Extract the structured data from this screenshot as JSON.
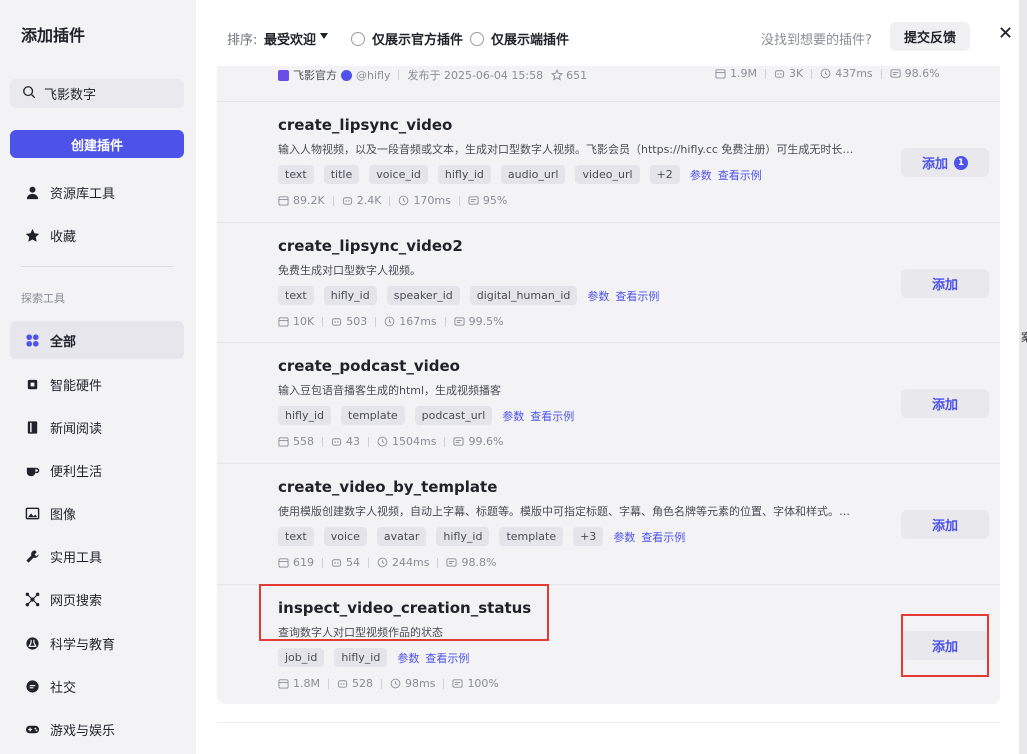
{
  "sidebar": {
    "title": "添加插件",
    "search_value": "飞影数字",
    "create_label": "创建插件",
    "items_top": [
      {
        "label": "资源库工具",
        "icon": "user-icon"
      },
      {
        "label": "收藏",
        "icon": "star-icon"
      }
    ],
    "section_label": "探索工具",
    "items": [
      {
        "label": "全部",
        "icon": "grid-icon",
        "active": true
      },
      {
        "label": "智能硬件",
        "icon": "chip-icon"
      },
      {
        "label": "新闻阅读",
        "icon": "book-icon"
      },
      {
        "label": "便利生活",
        "icon": "cup-icon"
      },
      {
        "label": "图像",
        "icon": "image-icon"
      },
      {
        "label": "实用工具",
        "icon": "wrench-icon"
      },
      {
        "label": "网页搜索",
        "icon": "network-icon"
      },
      {
        "label": "科学与教育",
        "icon": "flask-icon"
      },
      {
        "label": "社交",
        "icon": "chat-icon"
      },
      {
        "label": "游戏与娱乐",
        "icon": "gamepad-icon"
      }
    ]
  },
  "topbar": {
    "sort_label": "排序:",
    "sort_value": "最受欢迎",
    "radio_official": "仅展示官方插件",
    "radio_edge": "仅展示端插件",
    "not_found": "没找到想要的插件?",
    "feedback": "提交反馈"
  },
  "previous": {
    "author": "飞影官方",
    "handle": "@hifly",
    "published": "发布于 2025-06-04 15:58",
    "favorites": "651",
    "stats": [
      "1.9M",
      "3K",
      "437ms",
      "98.6%"
    ]
  },
  "cards": [
    {
      "name": "create_lipsync_video",
      "desc": "输入人物视频，以及一段音频或文本，生成对口型数字人视频。飞影会员（https://hifly.cc 免费注册）可生成无时长…",
      "tags": [
        "text",
        "title",
        "voice_id",
        "hifly_id",
        "audio_url",
        "video_url",
        "+2"
      ],
      "params": "参数",
      "example": "查看示例",
      "stats": [
        "89.2K",
        "2.4K",
        "170ms",
        "95%"
      ],
      "add": "添加",
      "badge": "1"
    },
    {
      "name": "create_lipsync_video2",
      "desc": "免费生成对口型数字人视频。",
      "tags": [
        "text",
        "hifly_id",
        "speaker_id",
        "digital_human_id"
      ],
      "params": "参数",
      "example": "查看示例",
      "stats": [
        "10K",
        "503",
        "167ms",
        "99.5%"
      ],
      "add": "添加"
    },
    {
      "name": "create_podcast_video",
      "desc": "输入豆包语音播客生成的html，生成视频播客",
      "tags": [
        "hifly_id",
        "template",
        "podcast_url"
      ],
      "params": "参数",
      "example": "查看示例",
      "stats": [
        "558",
        "43",
        "1504ms",
        "99.6%"
      ],
      "add": "添加"
    },
    {
      "name": "create_video_by_template",
      "desc": "使用模版创建数字人视频，自动上字幕、标题等。模版中可指定标题、字幕、角色名牌等元素的位置、字体和样式。…",
      "tags": [
        "text",
        "voice",
        "avatar",
        "hifly_id",
        "template",
        "+3"
      ],
      "params": "参数",
      "example": "查看示例",
      "stats": [
        "619",
        "54",
        "244ms",
        "98.8%"
      ],
      "add": "添加"
    },
    {
      "name": "inspect_video_creation_status",
      "desc": "查询数字人对口型视频作品的状态",
      "tags": [
        "job_id",
        "hifly_id"
      ],
      "params": "参数",
      "example": "查看示例",
      "stats": [
        "1.8M",
        "528",
        "98ms",
        "100%"
      ],
      "add": "添加"
    }
  ],
  "edge_char": "案",
  "colors": {
    "accent": "#4d53e8",
    "highlight": "#e53935"
  }
}
